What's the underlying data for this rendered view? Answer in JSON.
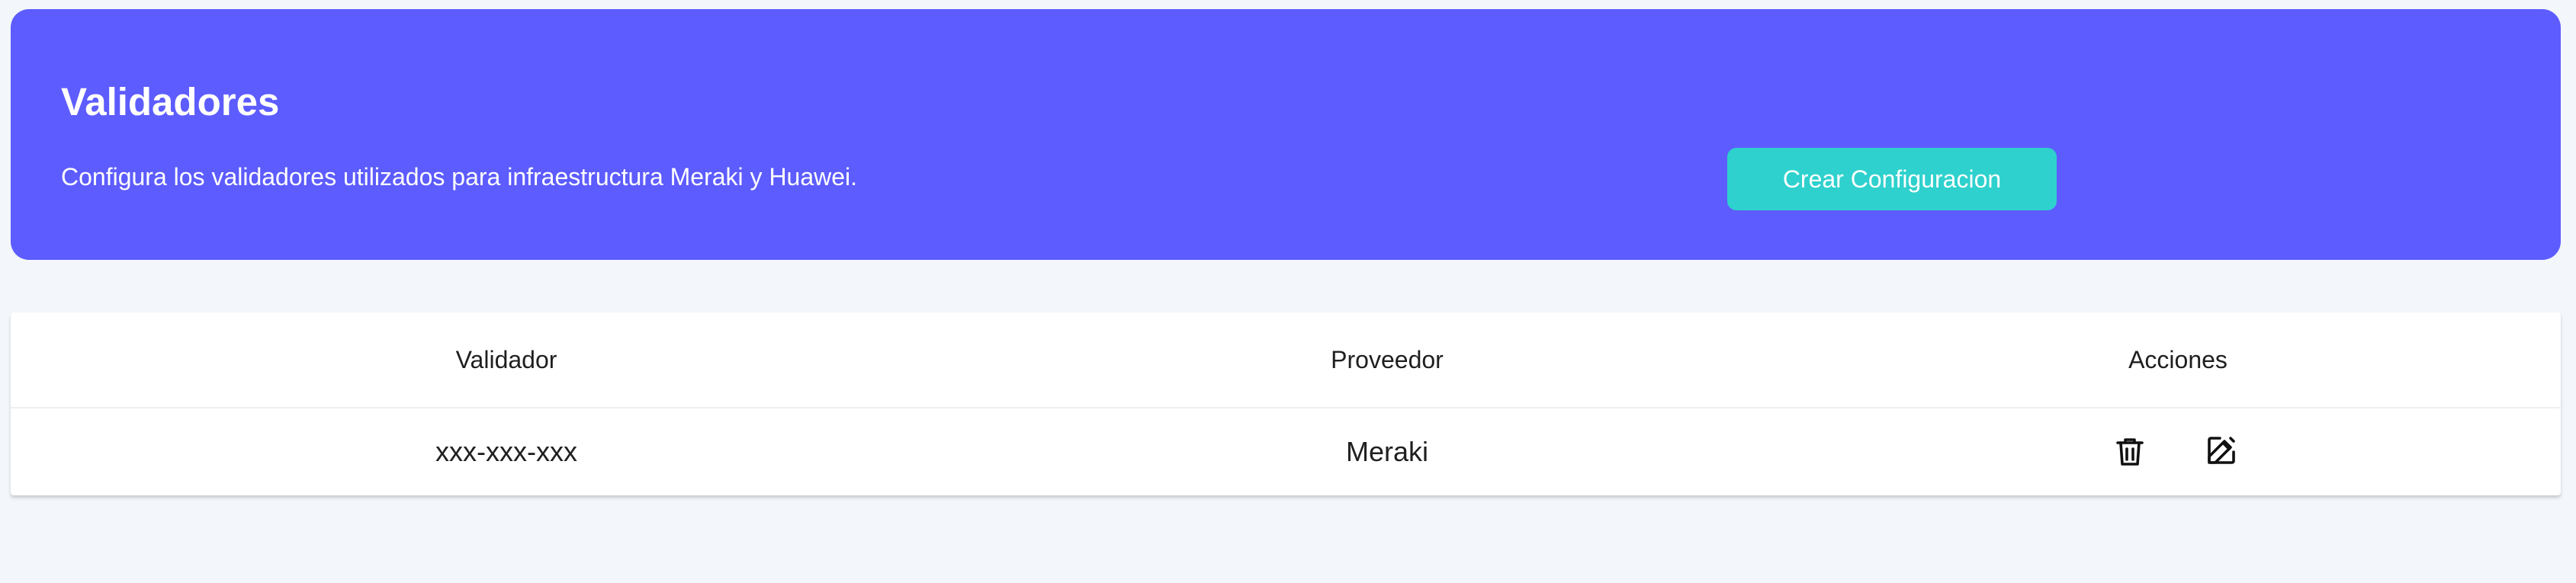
{
  "header": {
    "title": "Validadores",
    "description": "Configura los validadores utilizados para infraestructura Meraki y Huawei.",
    "create_button_label": "Crear Configuracion"
  },
  "table": {
    "columns": [
      "Validador",
      "Proveedor",
      "Acciones"
    ],
    "rows": [
      {
        "validador": "xxx-xxx-xxx",
        "proveedor": "Meraki",
        "actions": [
          "trash-icon",
          "pencil-edit-icon"
        ]
      }
    ]
  },
  "colors": {
    "banner": "#5d5cfe",
    "button": "#2ed1cd",
    "page_background": "#f3f6fa"
  }
}
